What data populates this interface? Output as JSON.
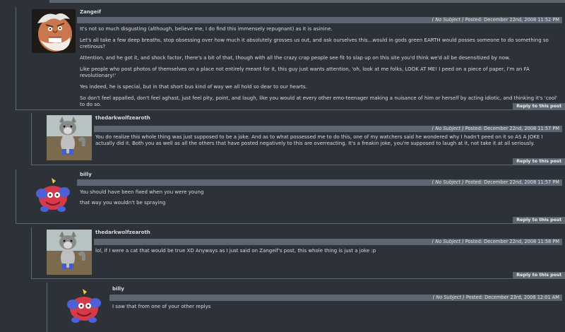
{
  "comments": [
    {
      "user": "Zangeif",
      "subject": "( No Subject )",
      "posted": "Posted: December 22nd, 2008 11:52 PM",
      "paragraphs": [
        "It's not so much disgusting (although, believe me, I do find this immensely repugnant) as it is asinine.",
        "Let's all take a few deep breaths, stop obsessing over how much it absolutely grosses us out, and ask ourselves this...would in gods green EARTH would posses someone to do something so cretinous?",
        "Attention, and he got it, and shock factor, there's a bit of that, though with all the crazy crap people see fit to slap up on this site you'd think we'd all be desensitized by now.",
        "Like people who post photos of themselves on a place not entirely meant for it, this guy just wants attention, 'oh, look at me folks, LOOK AT ME! I peed on a piece of paper, I'm an FA revolutionary!'",
        "Yes indeed, he is special, but in that short bus kind of way we all hold so dear to our hearts.",
        "So don't feel appalled, don't feel aghast, just feel pity, point, and laugh, like you would at every other emo-teenager making a nuisance of him or herself by acting idiotic, and thinking it's 'cool' to do so."
      ],
      "reply": "Reply to this post"
    },
    {
      "user": "thedarkwolfzearoth",
      "subject": "( No Subject )",
      "posted": "Posted: December 22nd, 2008 11:57 PM",
      "paragraphs": [
        "You do realize this whole thing was just supposed to be a joke. And as to what possessed me to do this, one of my watchers said he wondered why I hadn't peed on it so AS A JOKE I actually did it. Both you as well as all the others that have posted negatively to this are overreacting. It's a freakin joke, you're supposed to laugh at it, not take it at all seriously."
      ],
      "reply": "Reply to this post"
    },
    {
      "user": "billy",
      "subject": "( No Subject )",
      "posted": "Posted: December 22nd, 2008 11:57 PM",
      "paragraphs": [
        "You should have been fixed when you were young",
        "that way you wouldn't be spraying"
      ],
      "reply": "Reply to this post"
    },
    {
      "user": "thedarkwolfzearoth",
      "subject": "( No Subject )",
      "posted": "Posted: December 22nd, 2008 11:58 PM",
      "paragraphs": [
        "lol, if I were a cat that would be true XD Anyways as I just said on Zangeif's post, this whole thing is just a joke :p"
      ],
      "reply": "Reply to this post"
    },
    {
      "user": "billy",
      "subject": "( No Subject )",
      "posted": "Posted: December 23rd, 2008 12:01 AM",
      "paragraphs": [
        "I saw that from one of your other replys"
      ],
      "reply": ""
    }
  ],
  "avatars": {
    "zangeif": "angry-wrestler-face",
    "wolf": "gray-wolf-cartoon",
    "billy": "red-round-creature"
  },
  "colors": {
    "page_bg": "#2c3238",
    "bar": "#5d6670",
    "text": "#d9dde1"
  }
}
